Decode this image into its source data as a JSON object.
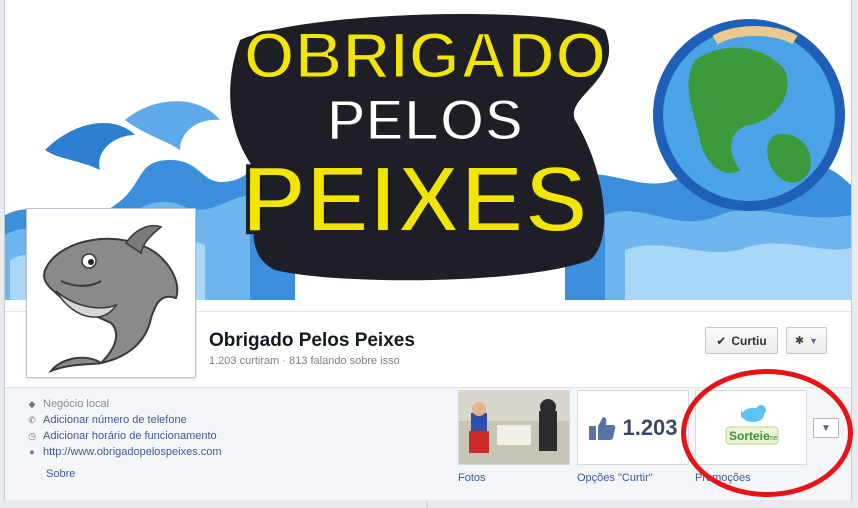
{
  "cover": {
    "title_line1": "OBRIGADO",
    "title_line2": "PELOS",
    "title_line3": "PEIXES"
  },
  "page": {
    "name": "Obrigado Pelos Peixes",
    "stats": "1.203 curtiram · 813 falando sobre isso"
  },
  "actions": {
    "liked_label": "Curtiu",
    "gear_icon": "gear-icon"
  },
  "info": {
    "category": "Negócio local",
    "add_phone": "Adicionar número de telefone",
    "add_hours": "Adicionar horário de funcionamento",
    "website": "http://www.obrigadopelospeixes.com",
    "about": "Sobre"
  },
  "apps": {
    "photos_label": "Fotos",
    "likes_count": "1.203",
    "likes_label": "Opções \"Curtir\"",
    "promos_label": "Promoções",
    "promos_logo_text": "Sorteie",
    "promos_logo_suffix": ".me"
  },
  "colors": {
    "link": "#3b5998",
    "highlight_circle": "#e61414",
    "cover_yellow": "#f2e500",
    "cover_blue": "#2d7fd0"
  }
}
